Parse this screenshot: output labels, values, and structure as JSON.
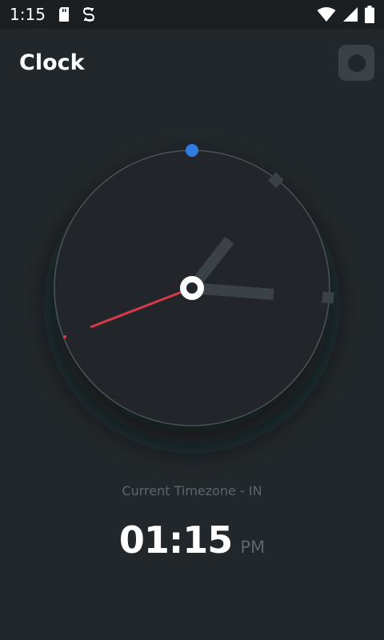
{
  "status_bar": {
    "time": "1:15",
    "left_icons": [
      "sd-card-icon",
      "sync-icon"
    ],
    "right_icons": [
      "wifi-icon",
      "signal-icon",
      "battery-icon"
    ]
  },
  "header": {
    "title": "Clock",
    "theme_toggle_icon": "theme-toggle-icon"
  },
  "clock": {
    "hour": 1,
    "minute": 15,
    "second": 40,
    "colors": {
      "face_border": "#4a5257",
      "hand": "#3a4247",
      "second_hand": "#d63a48",
      "marker_top": "#2f7de1",
      "center": "#ffffff"
    }
  },
  "timezone_label": "Current Timezone - IN",
  "digital": {
    "time": "01:15",
    "period": "PM"
  }
}
